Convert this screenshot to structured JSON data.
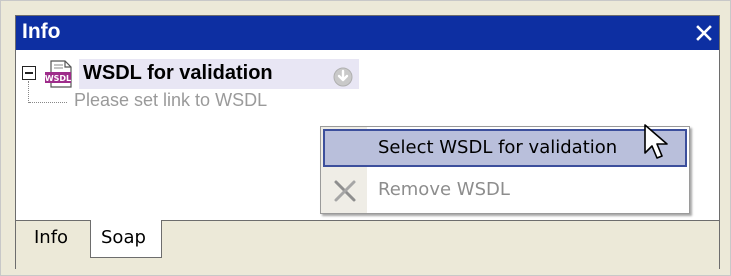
{
  "panel": {
    "title": "Info",
    "close_icon": "close-icon"
  },
  "tree": {
    "root": {
      "icon": "wsdl-file-icon",
      "label": "WSDL for validation",
      "dropdown_icon": "dropdown-arrow-icon"
    },
    "child": {
      "label": "Please set link to WSDL"
    }
  },
  "context_menu": {
    "items": [
      {
        "label": "Select WSDL for validation",
        "state": "highlighted"
      },
      {
        "label": "Remove WSDL",
        "state": "disabled",
        "icon": "remove-icon"
      }
    ]
  },
  "tabs": [
    {
      "label": "Info",
      "active": false
    },
    {
      "label": "Soap",
      "active": true
    }
  ],
  "colors": {
    "titlebar": "#0d2fa2",
    "highlight": "#b9bfdb",
    "highlight_border": "#3c4f9c",
    "disabled_text": "#8d8d8d"
  }
}
